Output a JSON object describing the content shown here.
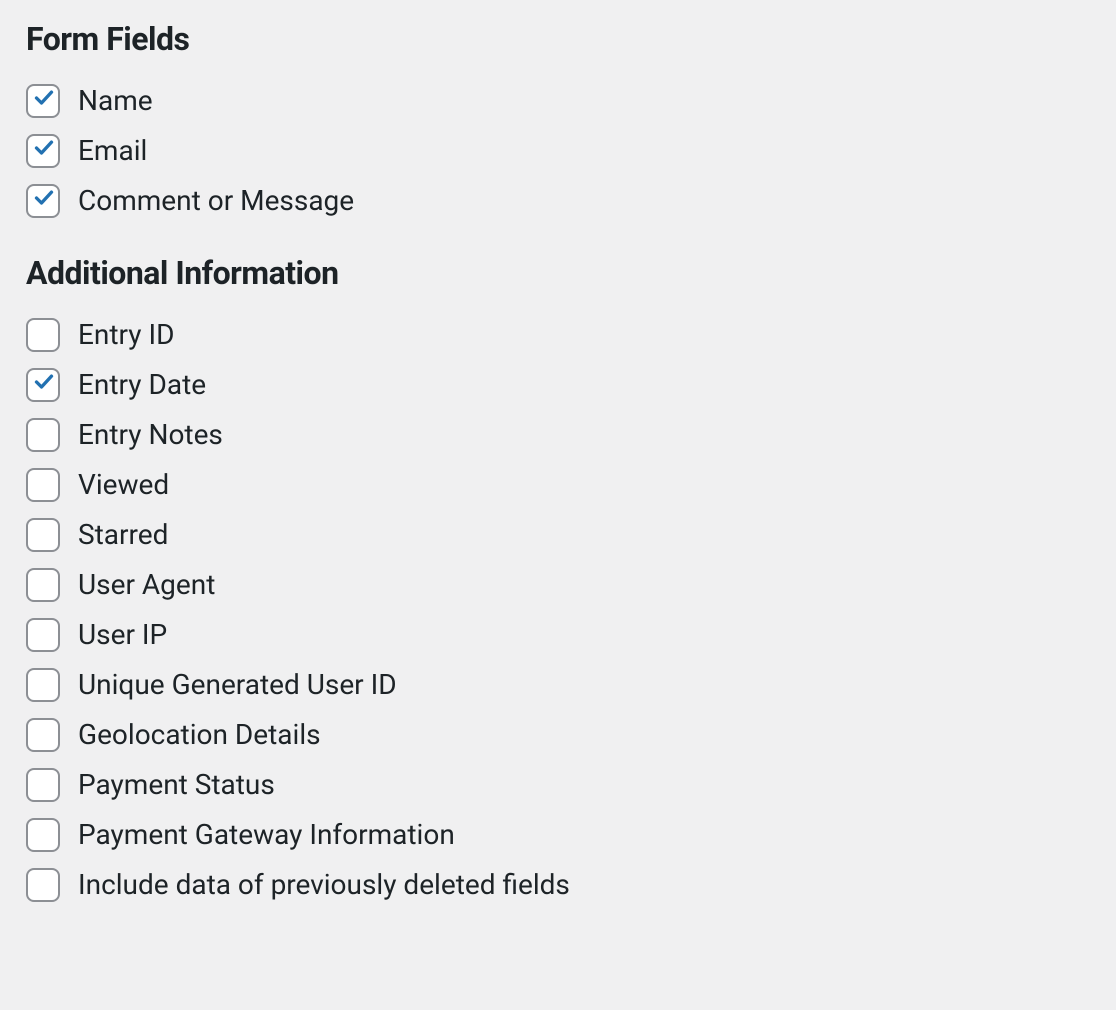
{
  "sections": [
    {
      "heading": "Form Fields",
      "key": "form-fields",
      "items": [
        {
          "key": "name",
          "label": "Name",
          "checked": true
        },
        {
          "key": "email",
          "label": "Email",
          "checked": true
        },
        {
          "key": "comment-or-message",
          "label": "Comment or Message",
          "checked": true
        }
      ]
    },
    {
      "heading": "Additional Information",
      "key": "additional-information",
      "items": [
        {
          "key": "entry-id",
          "label": "Entry ID",
          "checked": false
        },
        {
          "key": "entry-date",
          "label": "Entry Date",
          "checked": true
        },
        {
          "key": "entry-notes",
          "label": "Entry Notes",
          "checked": false
        },
        {
          "key": "viewed",
          "label": "Viewed",
          "checked": false
        },
        {
          "key": "starred",
          "label": "Starred",
          "checked": false
        },
        {
          "key": "user-agent",
          "label": "User Agent",
          "checked": false
        },
        {
          "key": "user-ip",
          "label": "User IP",
          "checked": false
        },
        {
          "key": "unique-generated-user-id",
          "label": "Unique Generated User ID",
          "checked": false
        },
        {
          "key": "geolocation-details",
          "label": "Geolocation Details",
          "checked": false
        },
        {
          "key": "payment-status",
          "label": "Payment Status",
          "checked": false
        },
        {
          "key": "payment-gateway-information",
          "label": "Payment Gateway Information",
          "checked": false
        },
        {
          "key": "include-deleted-fields",
          "label": "Include data of previously deleted fields",
          "checked": false
        }
      ]
    }
  ]
}
